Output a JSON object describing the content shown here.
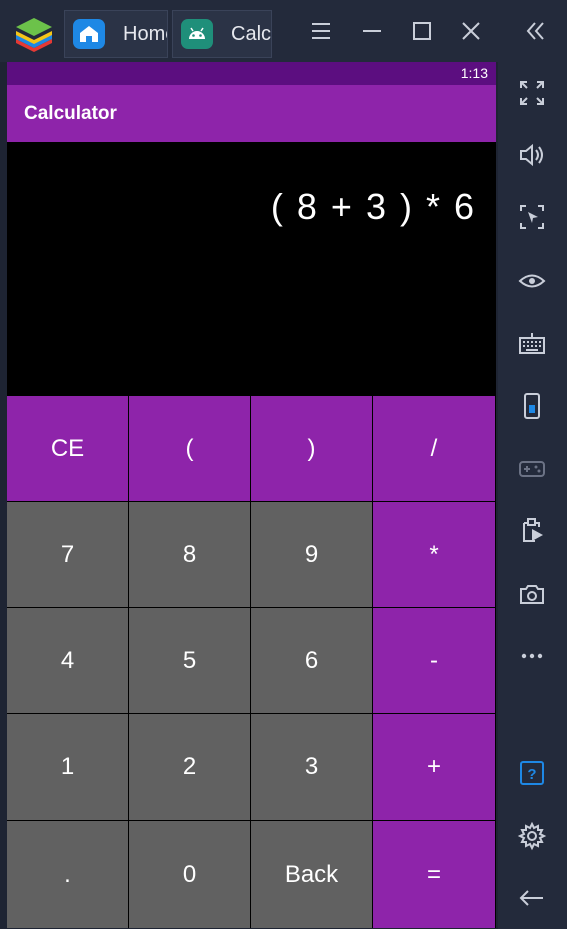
{
  "window": {
    "tabs": [
      {
        "label": "Home",
        "icon": "home-icon"
      },
      {
        "label": "Calculator",
        "icon": "android-icon"
      }
    ],
    "controls": [
      "menu-icon",
      "minimize-icon",
      "maximize-icon",
      "close-icon",
      "collapse-sidebar-icon"
    ]
  },
  "sidebar": {
    "icons": [
      "fullscreen-icon",
      "volume-icon",
      "screenshot-region-icon",
      "eye-icon",
      "keyboard-icon",
      "device-icon",
      "gamepad-icon",
      "install-apk-icon",
      "camera-icon",
      "more-icon",
      "help-icon",
      "settings-icon",
      "back-icon"
    ]
  },
  "status_bar": {
    "time": "1:13"
  },
  "app": {
    "title": "Calculator"
  },
  "display": {
    "expression": "( 8 + 3 )  * 6"
  },
  "keys": [
    [
      "CE",
      "(",
      ")",
      "/"
    ],
    [
      "7",
      "8",
      "9",
      "*"
    ],
    [
      "4",
      "5",
      "6",
      "-"
    ],
    [
      "1",
      "2",
      "3",
      "+"
    ],
    [
      ".",
      "0",
      "Back",
      "="
    ]
  ],
  "colors": {
    "status_bar": "#5c0e80",
    "app_bar": "#8e24aa",
    "operator_key": "#8e24aa",
    "digit_key": "#616161",
    "display_bg": "#000000",
    "chrome_bg": "#232a3b"
  }
}
